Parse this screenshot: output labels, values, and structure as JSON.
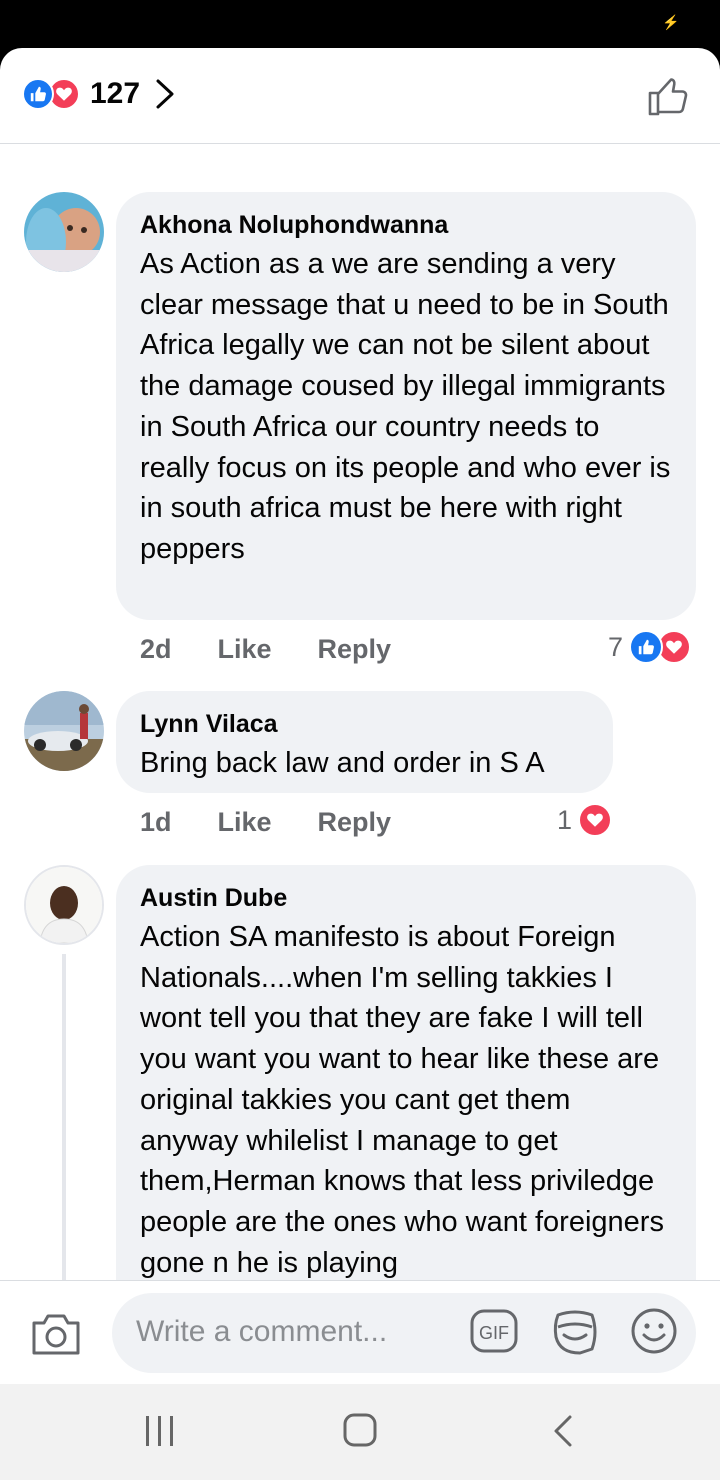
{
  "header": {
    "reaction_count": "127",
    "reaction_icons": [
      "like-icon",
      "love-icon"
    ]
  },
  "comments": [
    {
      "author": "Akhona Noluphondwanna",
      "text": "As Action as a we are sending a very clear message that u need to be in South Africa legally we can not be silent about the damage coused by illegal immigrants in South Africa our country needs to really focus on its people and who ever is in south africa must be here with right peppers",
      "time": "2d",
      "like_label": "Like",
      "reply_label": "Reply",
      "reaction_count": "7"
    },
    {
      "author": "Lynn Vilaca",
      "text": "Bring back law and order in S A",
      "time": "1d",
      "like_label": "Like",
      "reply_label": "Reply",
      "reaction_count": "1"
    },
    {
      "author": "Austin Dube",
      "text": "Action SA manifesto is about Foreign Nationals....when I'm selling takkies I wont tell you that they are fake I will tell you want you want to hear like these are original takkies you cant get them anyway whilelist  I manage to get them,Herman  knows that less priviledge  people are the ones who want foreigners gone n he is playing"
    }
  ],
  "composer": {
    "placeholder": "Write a comment..."
  },
  "colors": {
    "like_blue": "#1877f2",
    "love_red": "#f33e58",
    "bubble_bg": "#f0f2f5",
    "meta_gray": "#65676b"
  }
}
